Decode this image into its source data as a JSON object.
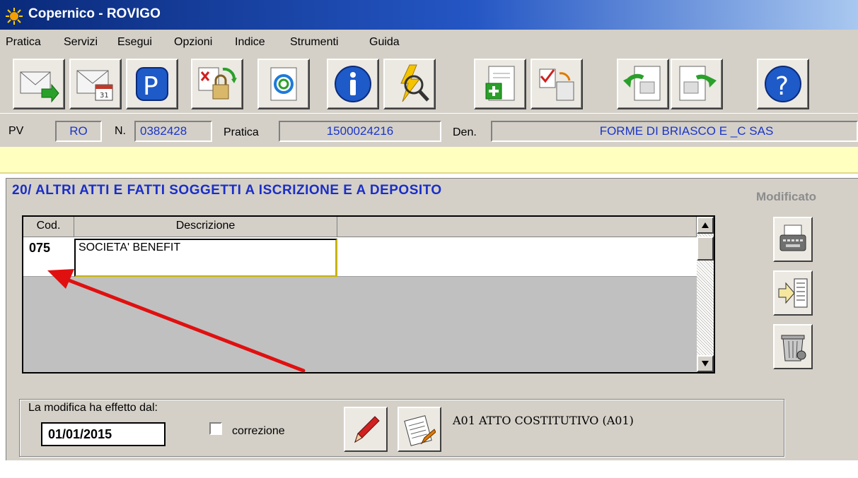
{
  "window": {
    "title": "Copernico - ROVIGO",
    "logo_icon": "sun-icon"
  },
  "menu": [
    "Pratica",
    "Servizi",
    "Esegui",
    "Opzioni",
    "Indice",
    "Strumenti",
    "Guida"
  ],
  "toolbar": [
    {
      "icon": "mail-send-icon"
    },
    {
      "icon": "mail-calendar-icon"
    },
    {
      "icon": "parking-p-icon"
    },
    {
      "icon": "lock-exchange-icon"
    },
    {
      "icon": "document-refresh-icon"
    },
    {
      "icon": "info-icon"
    },
    {
      "icon": "lightning-search-icon"
    },
    {
      "icon": "document-add-icon"
    },
    {
      "icon": "check-swap-icon"
    },
    {
      "icon": "document-back-icon"
    },
    {
      "icon": "document-forward-icon"
    },
    {
      "icon": "help-icon"
    }
  ],
  "info": {
    "pv_label": "PV",
    "pv_value": "RO",
    "n_label": "N.",
    "n_value": "0382428",
    "pratica_label": "Pratica",
    "pratica_value": "1500024216",
    "den_label": "Den.",
    "den_value": "FORME DI BRIASCO E _C SAS"
  },
  "section": {
    "title": "20/ ALTRI ATTI E FATTI SOGGETTI A ISCRIZIONE E A DEPOSITO",
    "status": "Modificato"
  },
  "grid": {
    "headers": [
      "Cod.",
      "Descrizione",
      ""
    ],
    "rows": [
      {
        "cod": "075",
        "descrizione": "SOCIETA' BENEFIT"
      }
    ]
  },
  "side_buttons": [
    {
      "icon": "typewriter-icon"
    },
    {
      "icon": "arrow-into-list-icon"
    },
    {
      "icon": "trash-icon"
    }
  ],
  "effect": {
    "label": "La modifica ha effetto dal:",
    "date": "01/01/2015",
    "correzione_label": "correzione",
    "correzione_checked": false,
    "edit_icon": "pencil-icon",
    "notepad_icon": "notepad-icon",
    "atto": "A01 ATTO COSTITUTIVO (A01)"
  },
  "colors": {
    "accent_blue": "#1a2ec8",
    "annotation_red": "#e01010",
    "highlight_yellow": "#ffffc0"
  }
}
